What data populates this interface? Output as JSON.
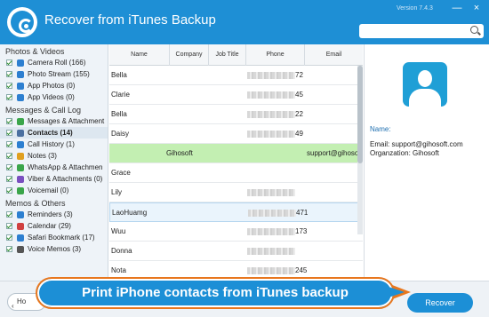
{
  "app": {
    "title": "Recover from iTunes Backup",
    "version": "Version 7.4.3"
  },
  "window": {
    "minimize": "—",
    "close": "×"
  },
  "search": {
    "placeholder": ""
  },
  "sidebar": {
    "categories": [
      {
        "label": "Photos & Videos",
        "items": [
          {
            "label": "Camera Roll (166)",
            "icon": "camera-icon",
            "color": "#2d7fd0"
          },
          {
            "label": "Photo Stream (155)",
            "icon": "photo-stream-icon",
            "color": "#2d7fd0"
          },
          {
            "label": "App Photos (0)",
            "icon": "app-photos-icon",
            "color": "#2d7fd0"
          },
          {
            "label": "App Videos (0)",
            "icon": "app-videos-icon",
            "color": "#2d7fd0"
          }
        ]
      },
      {
        "label": "Messages & Call Log",
        "items": [
          {
            "label": "Messages & Attachment",
            "icon": "messages-icon",
            "color": "#3aa54a"
          },
          {
            "label": "Contacts (14)",
            "icon": "contacts-icon",
            "color": "#4a6fa0",
            "active": true
          },
          {
            "label": "Call History (1)",
            "icon": "call-history-icon",
            "color": "#2d7fd0"
          },
          {
            "label": "Notes (3)",
            "icon": "notes-icon",
            "color": "#e0a020"
          },
          {
            "label": "WhatsApp & Attachmen",
            "icon": "whatsapp-icon",
            "color": "#3aa54a"
          },
          {
            "label": "Viber & Attachments (0)",
            "icon": "viber-icon",
            "color": "#7a4fc0"
          },
          {
            "label": "Voicemail (0)",
            "icon": "voicemail-icon",
            "color": "#3aa54a"
          }
        ]
      },
      {
        "label": "Memos & Others",
        "items": [
          {
            "label": "Reminders (3)",
            "icon": "reminders-icon",
            "color": "#2d7fd0"
          },
          {
            "label": "Calendar (29)",
            "icon": "calendar-icon",
            "color": "#d04040"
          },
          {
            "label": "Safari Bookmark (17)",
            "icon": "safari-icon",
            "color": "#2d7fd0"
          },
          {
            "label": "Voice Memos (3)",
            "icon": "voice-memos-icon",
            "color": "#555555"
          }
        ]
      }
    ]
  },
  "table": {
    "columns": [
      "Name",
      "Company",
      "Job Title",
      "Phone",
      "Email"
    ],
    "rows": [
      {
        "name": "Bella",
        "phone_tail": "72",
        "email": ""
      },
      {
        "name": "Clarie",
        "phone_tail": "45",
        "email": ""
      },
      {
        "name": "Bella",
        "phone_tail": "22",
        "email": ""
      },
      {
        "name": "Daisy",
        "phone_tail": "49",
        "email": ""
      },
      {
        "name": "Gihosoft",
        "phone_tail": "",
        "email": "support@gihosoft",
        "highlight": true
      },
      {
        "name": "Grace",
        "phone_tail": "",
        "email": ""
      },
      {
        "name": "Lily",
        "phone_tail": "",
        "email": ""
      },
      {
        "name": "LaoHuamg",
        "phone_tail": "471",
        "email": "",
        "selected": true
      },
      {
        "name": "Wuu",
        "phone_tail": "173",
        "email": ""
      },
      {
        "name": "Donna",
        "phone_tail": "",
        "email": ""
      },
      {
        "name": "Nota",
        "phone_tail": "245",
        "email": ""
      }
    ]
  },
  "detail": {
    "name_label": "Name:",
    "email_line": "Email: support@gihosoft.com",
    "org_line": "Organzation: Gihosoft"
  },
  "footer": {
    "home_label": "Ho",
    "recover_label": "Recover"
  },
  "banner": {
    "text": "Print iPhone contacts from iTunes backup"
  },
  "colors": {
    "accent": "#1e8fd5",
    "highlight_row": "#c3efb2",
    "banner_border": "#e8771e"
  }
}
